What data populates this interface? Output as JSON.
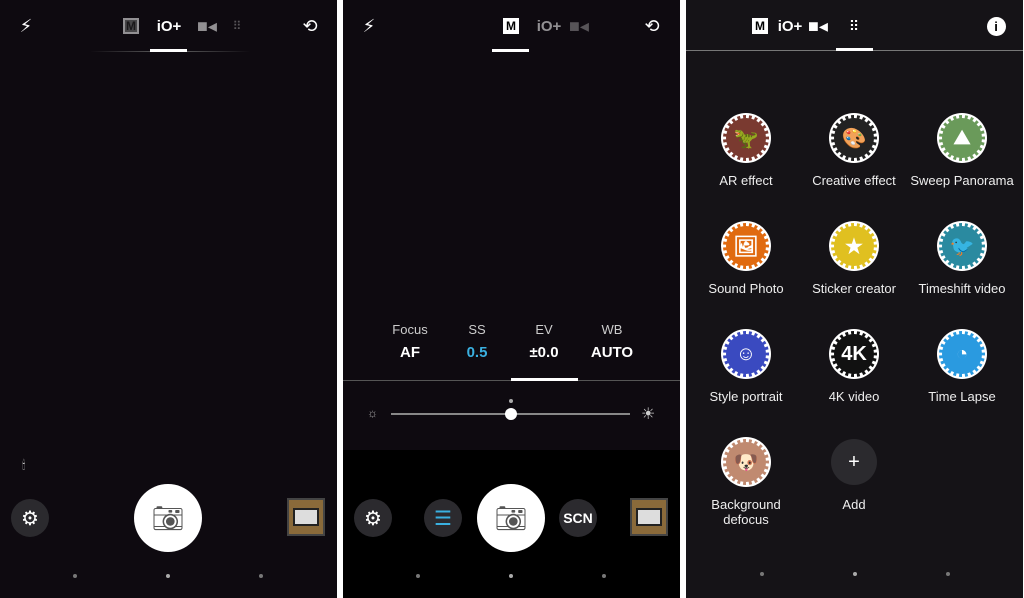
{
  "modes": {
    "manual": "M",
    "intelligent_auto": "iO+",
    "video": "video",
    "more": "more"
  },
  "panel1": {
    "icons": [
      "flash-off-icon",
      "switch-camera-icon",
      "settings-icon",
      "shutter-icon",
      "gallery-thumbnail"
    ]
  },
  "panel2": {
    "params": [
      {
        "label": "Focus",
        "value": "AF"
      },
      {
        "label": "SS",
        "value": "0.5",
        "color": "#3ab0e0"
      },
      {
        "label": "EV",
        "value": "±0.0"
      },
      {
        "label": "WB",
        "value": "AUTO"
      }
    ],
    "selected_param": "EV",
    "ev_slider_position": 0.5,
    "scn_label": "SCN"
  },
  "panel3": {
    "apps": [
      {
        "label": "AR effect",
        "color": "#7a3a30"
      },
      {
        "label": "Creative effect",
        "color": "#222"
      },
      {
        "label": "Sweep Panorama",
        "color": "#6a9a5a"
      },
      {
        "label": "Sound Photo",
        "color": "#e06a10"
      },
      {
        "label": "Sticker creator",
        "color": "#e0c020"
      },
      {
        "label": "Timeshift video",
        "color": "#2a8aa0"
      },
      {
        "label": "Style portrait",
        "color": "#3a4ac0"
      },
      {
        "label": "4K video",
        "color": "#111"
      },
      {
        "label": "Time Lapse",
        "color": "#2a9ae0"
      },
      {
        "label": "Background defocus",
        "color": "#c08a70"
      },
      {
        "label": "Add",
        "color": "#2b2a2e"
      }
    ]
  }
}
